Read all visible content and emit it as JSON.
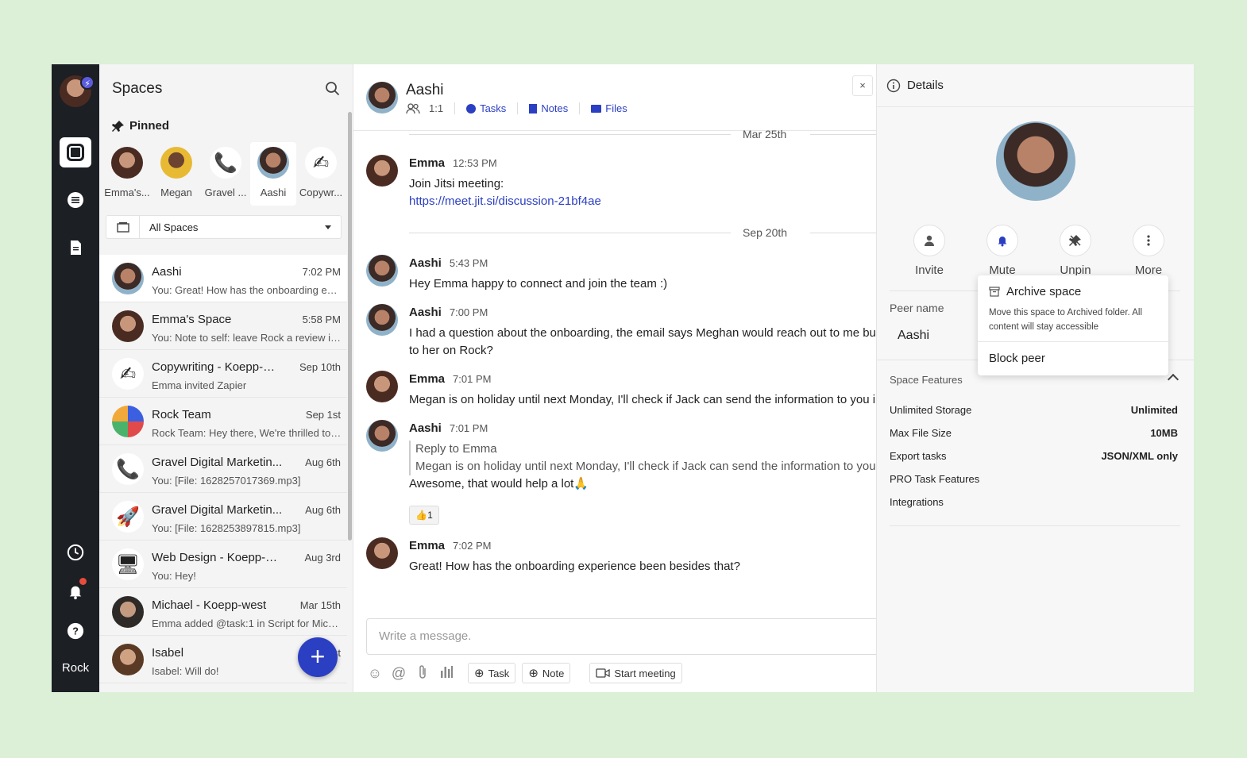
{
  "rail": {
    "brand": "Rock",
    "badge": "⚡"
  },
  "spaces": {
    "title": "Spaces",
    "pinned_title": "Pinned",
    "pinned": [
      {
        "label": "Emma's..."
      },
      {
        "label": "Megan"
      },
      {
        "label": "Gravel ..."
      },
      {
        "label": "Aashi"
      },
      {
        "label": "Copywr..."
      }
    ],
    "filter_value": "All Spaces",
    "list": [
      {
        "name": "Aashi",
        "time": "7:02 PM",
        "preview": "You: Great! How has the onboarding exp..."
      },
      {
        "name": "Emma's Space",
        "time": "5:58 PM",
        "preview": "You: Note to self: leave Rock a review in ..."
      },
      {
        "name": "Copywriting - Koepp-W...",
        "time": "Sep 10th",
        "preview": "Emma invited Zapier"
      },
      {
        "name": "Rock Team",
        "time": "Sep 1st",
        "preview": "Rock Team: Hey there, We're thrilled to a..."
      },
      {
        "name": "Gravel Digital Marketin...",
        "time": "Aug 6th",
        "preview": "You: [File: 1628257017369.mp3]"
      },
      {
        "name": "Gravel Digital Marketin...",
        "time": "Aug 6th",
        "preview": "You: [File: 1628253897815.mp3]"
      },
      {
        "name": "Web Design - Koepp-W...",
        "time": "Aug 3rd",
        "preview": "You: Hey!"
      },
      {
        "name": "Michael - Koepp-west",
        "time": "Mar 15th",
        "preview": "Emma added @task:1 in Script for Mich..."
      },
      {
        "name": "Isabel",
        "time": "st",
        "preview": "Isabel: Will do!"
      }
    ],
    "fab": "+"
  },
  "chat": {
    "title": "Aashi",
    "members": "1:1",
    "tabs": {
      "tasks": "Tasks",
      "notes": "Notes",
      "files": "Files"
    },
    "close": "×",
    "sep_top": "Mar 25th",
    "sep_mid": "Sep 20th",
    "messages": [
      {
        "author": "Emma",
        "time": "12:53 PM",
        "line1": "Join Jitsi meeting:",
        "link": "https://meet.jit.si/discussion-21bf4ae"
      },
      {
        "author": "Aashi",
        "time": "5:43 PM",
        "line1": "Hey Emma happy to connect and join the team :)"
      },
      {
        "author": "Aashi",
        "time": "7:00 PM",
        "line1": "I had a question about the onboarding, the email says Meghan would reach out to me but",
        "line2": "to her on Rock?"
      },
      {
        "author": "Emma",
        "time": "7:01 PM",
        "line1": "Megan is on holiday until next Monday, I'll check if Jack can send the information to you i"
      },
      {
        "author": "Aashi",
        "time": "7:01 PM",
        "reply_to": "Reply to Emma",
        "quote": "Megan is on holiday until next Monday, I'll check if Jack can send the information to you",
        "line1": "Awesome, that would help a lot🙏"
      },
      {
        "author": "Emma",
        "time": "7:02 PM",
        "line1": "Great! How has the onboarding experience been besides that?"
      }
    ],
    "reaction": {
      "emoji": "👍",
      "count": "1"
    },
    "composer_placeholder": "Write a message.",
    "toolbar": {
      "task": "Task",
      "note": "Note",
      "meeting": "Start meeting"
    }
  },
  "details": {
    "title": "Details",
    "actions": {
      "invite": "Invite",
      "mute": "Mute",
      "unpin": "Unpin",
      "more": "More"
    },
    "peer_label": "Peer name",
    "peer_value": "Aashi",
    "features_title": "Space Features",
    "features": [
      {
        "name": "Unlimited Storage",
        "value": "Unlimited"
      },
      {
        "name": "Max File Size",
        "value": "10MB"
      },
      {
        "name": "Export tasks",
        "value": "JSON/XML only"
      },
      {
        "name": "PRO Task Features",
        "value": ""
      },
      {
        "name": "Integrations",
        "value": ""
      }
    ]
  },
  "menu": {
    "archive": "Archive space",
    "archive_desc": "Move this space to Archived folder. All content will stay accessible",
    "block": "Block peer"
  },
  "colors": {
    "accent": "#2b3fc2",
    "rail": "#1c1f24",
    "page_bg": "#dcefd7"
  }
}
